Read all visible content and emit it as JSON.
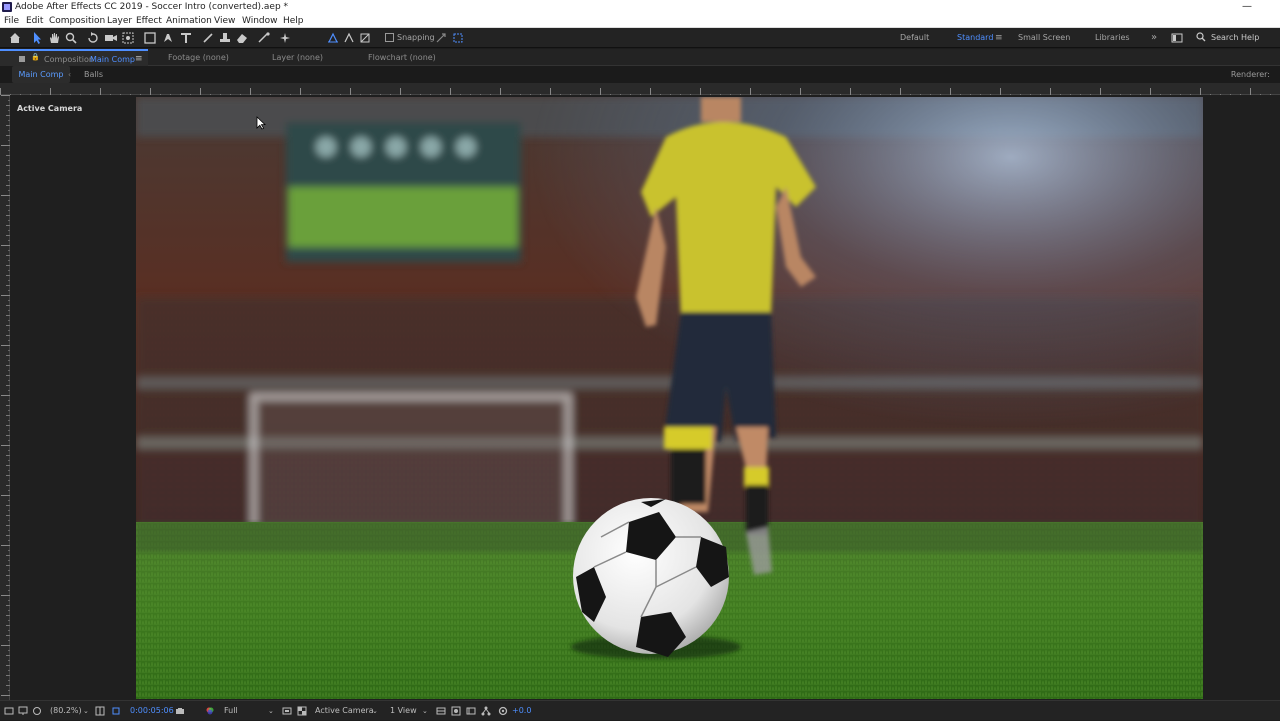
{
  "window": {
    "title": "Adobe After Effects CC 2019 - Soccer Intro (converted).aep *",
    "minimize_glyph": "—"
  },
  "menu": {
    "items": [
      "File",
      "Edit",
      "Composition",
      "Layer",
      "Effect",
      "Animation",
      "View",
      "Window",
      "Help"
    ]
  },
  "toolbar": {
    "snapping_label": "Snapping",
    "workspaces": [
      "Default",
      "Standard",
      "Small Screen",
      "Libraries"
    ],
    "active_workspace": "Standard",
    "overflow_glyph": "»",
    "search_label": "Search Help"
  },
  "panels": {
    "composition_prefix": "Composition",
    "composition_name": "Main Comp",
    "footage": "Footage (none)",
    "layer": "Layer (none)",
    "flowchart": "Flowchart (none)",
    "menu_glyph": "≡"
  },
  "breadcrumbs": {
    "items": [
      "Main Comp",
      "Balls"
    ],
    "separator": "‹",
    "renderer_label": "Renderer:"
  },
  "viewer": {
    "active_camera_label": "Active Camera"
  },
  "bottom": {
    "zoom": "(80.2%)",
    "timecode": "0:00:05:06",
    "resolution": "Full",
    "camera": "Active Camera",
    "views": "1 View",
    "exposure": "+0.0"
  },
  "colors": {
    "accent": "#4f8fff",
    "panel_bg": "#232323",
    "jersey": "#c9c22e",
    "grass": "#3f7a1f"
  }
}
